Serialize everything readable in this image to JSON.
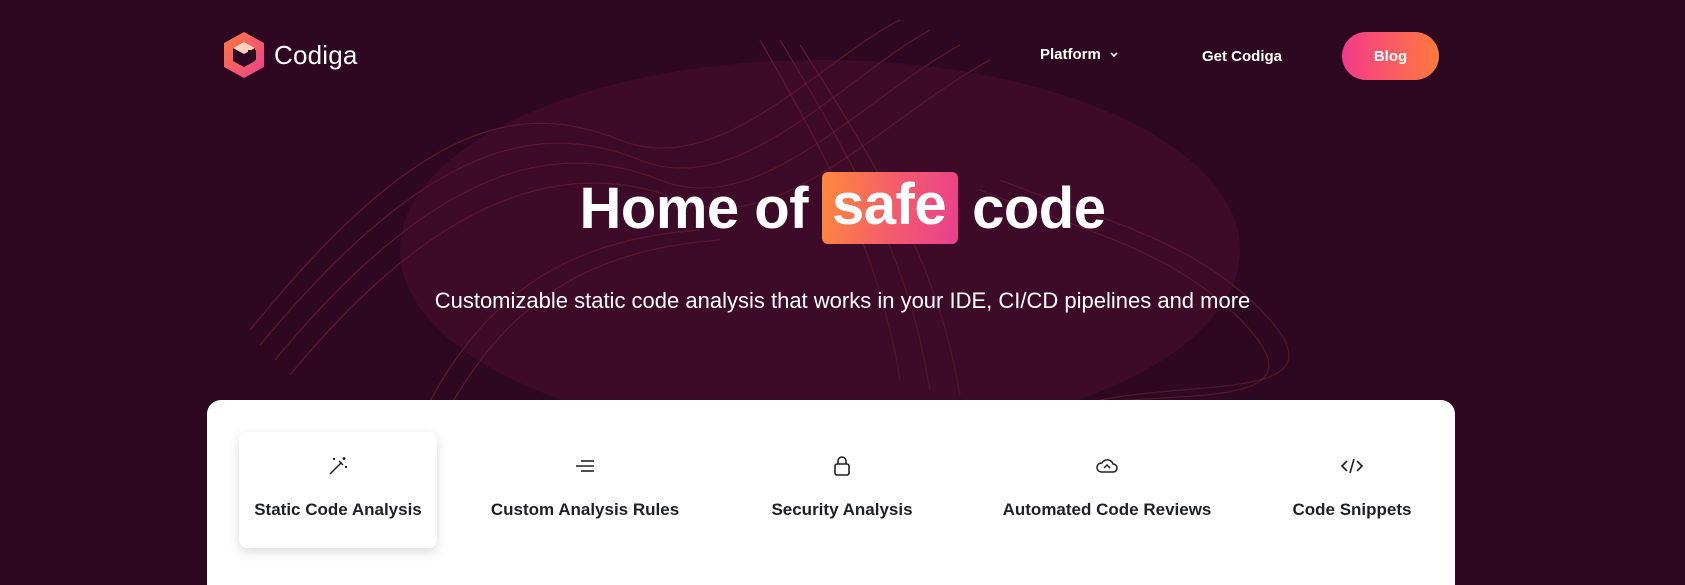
{
  "brand": {
    "name": "Codiga"
  },
  "nav": {
    "platform_label": "Platform",
    "get_label": "Get Codiga",
    "blog_label": "Blog"
  },
  "hero": {
    "title_before": "Home of",
    "title_highlight": "safe",
    "title_after": "code",
    "subtitle": "Customizable static code analysis that works in your IDE, CI/CD pipelines and more"
  },
  "features": {
    "tabs": [
      {
        "label": "Static Code Analysis",
        "icon": "magic-wand-icon",
        "active": true
      },
      {
        "label": "Custom Analysis Rules",
        "icon": "lines-icon",
        "active": false
      },
      {
        "label": "Security Analysis",
        "icon": "lock-icon",
        "active": false
      },
      {
        "label": "Automated Code Reviews",
        "icon": "cloud-icon",
        "active": false
      },
      {
        "label": "Code Snippets",
        "icon": "code-icon",
        "active": false
      }
    ]
  },
  "colors": {
    "background": "#2e0820",
    "accent_pink": "#f23a8a",
    "accent_orange": "#ff7a3d",
    "text_dark": "#1f1f2a"
  }
}
